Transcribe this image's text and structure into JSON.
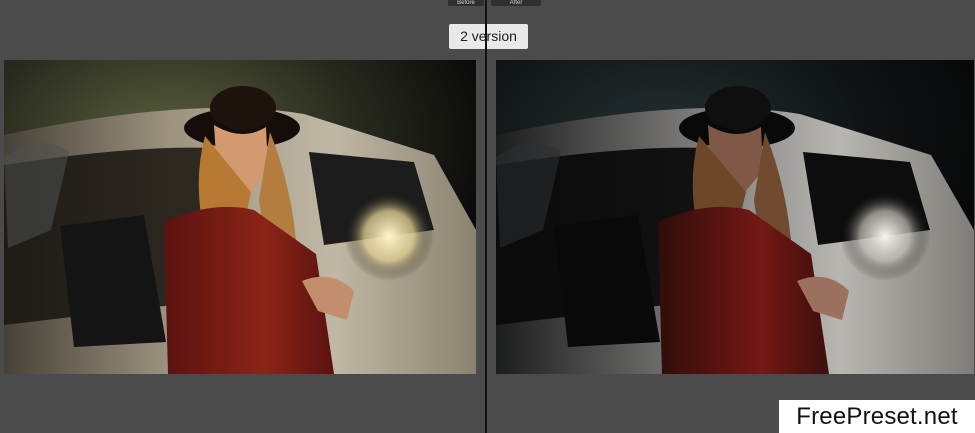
{
  "comparison": {
    "before_label": "Before",
    "after_label": "After",
    "version_label": "2 version"
  },
  "photos": {
    "before": {
      "alt": "before image"
    },
    "after": {
      "alt": "after image"
    }
  },
  "watermark": {
    "text": "FreePreset.net"
  },
  "colors": {
    "background": "#4b4b4b",
    "badge": "#e9e9e9",
    "divider": "#111111",
    "coat": "#7a1612",
    "car_body": "#b9b2a3"
  }
}
